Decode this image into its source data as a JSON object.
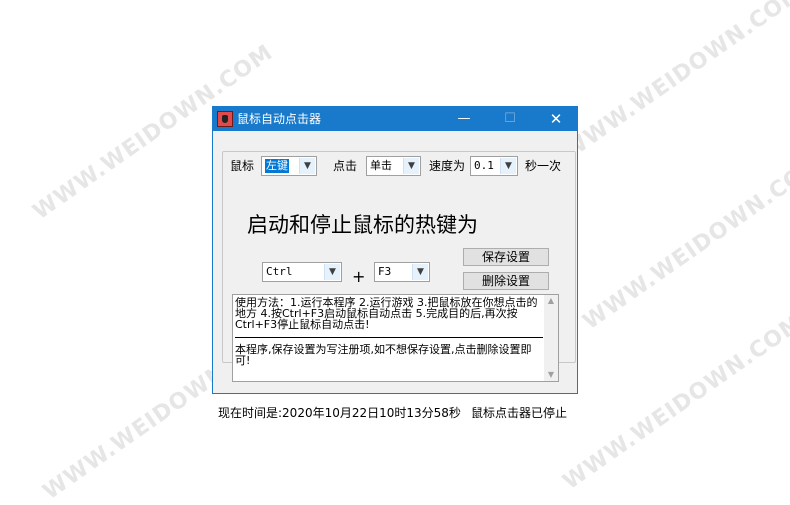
{
  "watermark": "WWW.WEIDOWN.COM",
  "window": {
    "title": "鼠标自动点击器",
    "min_glyph": "—",
    "max_glyph": "☐",
    "close_glyph": "✕"
  },
  "controls": {
    "mouse_label": "鼠标",
    "mouse_button": {
      "value": "左键"
    },
    "click_label": "点击",
    "click_type": {
      "value": "单击"
    },
    "speed_label": "速度为",
    "speed": {
      "value": "0.1"
    },
    "per_label": "秒一次"
  },
  "hotkey": {
    "title": "启动和停止鼠标的热键为",
    "modifier": {
      "value": "Ctrl"
    },
    "plus": "+",
    "key": {
      "value": "F3"
    },
    "save_label": "保存设置",
    "delete_label": "删除设置"
  },
  "instructions": {
    "text1": "使用方法：1.运行本程序 2.运行游戏 3.把鼠标放在你想点击的地方 4.按Ctrl+F3启动鼠标自动点击 5.完成目的后,再次按Ctrl+F3停止鼠标自动点击!",
    "text2": "本程序,保存设置为写注册项,如不想保存设置,点击删除设置即可!"
  },
  "status": {
    "time": "现在时间是:2020年10月22日10时13分58秒",
    "state": "鼠标点击器已停止"
  },
  "colors": {
    "accent": "#1979ca",
    "selection": "#0078d7"
  }
}
